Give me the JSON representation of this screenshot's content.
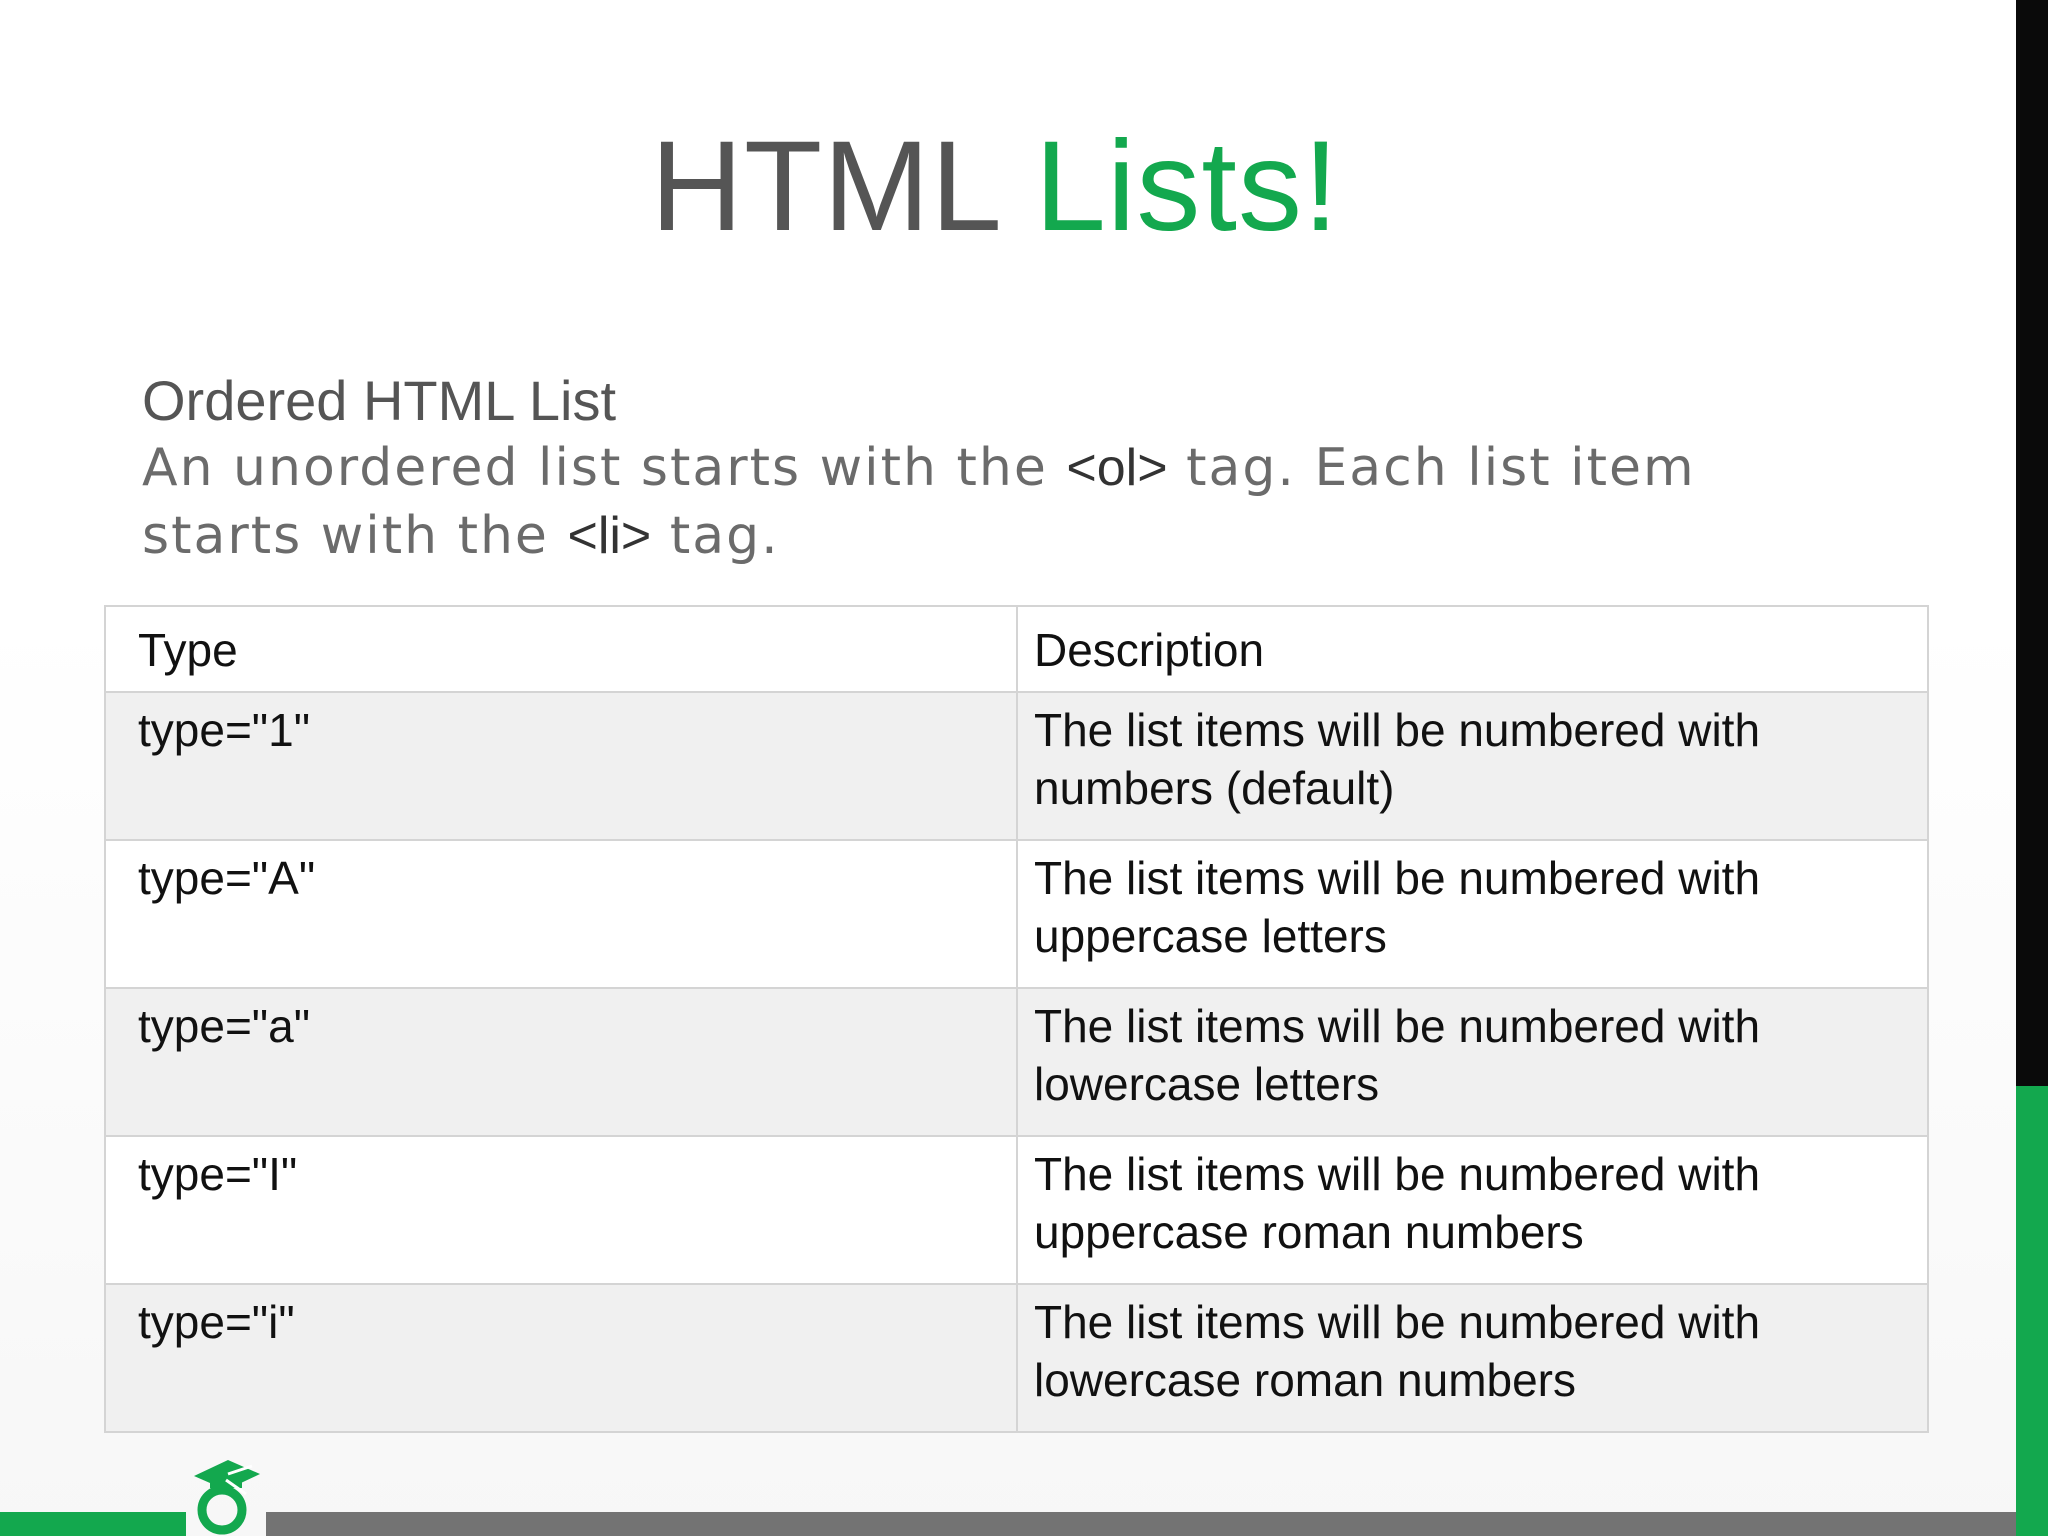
{
  "slide": {
    "title_part1": "HTML",
    "title_part2": "Lists!",
    "subtitle": "Ordered HTML List",
    "body": {
      "text1": "An unordered list starts with the ",
      "tag_ol": "<ol>",
      "text2": " tag. Each list item starts with the ",
      "tag_li": "<li>",
      "text3": " tag."
    }
  },
  "table": {
    "headers": [
      "Type",
      "Description"
    ],
    "rows": [
      {
        "type": "type=\"1\"",
        "description": "The list items will be numbered with numbers (default)"
      },
      {
        "type": "type=\"A\"",
        "description": "The list items will be numbered with uppercase letters"
      },
      {
        "type": "type=\"a\"",
        "description": "The list items will be numbered with lowercase letters"
      },
      {
        "type": "type=\"I\"",
        "description": "The list items will be numbered with uppercase roman numbers"
      },
      {
        "type": "type=\"i\"",
        "description": "The list items will be numbered with lowercase roman numbers"
      }
    ]
  },
  "colors": {
    "accent_green": "#13a84e",
    "title_gray": "#555555",
    "right_bar_dark": "#0a0a0a",
    "bottom_bar_gray": "#737373"
  },
  "icons": {
    "logo": "graduation-cap-logo-icon"
  }
}
